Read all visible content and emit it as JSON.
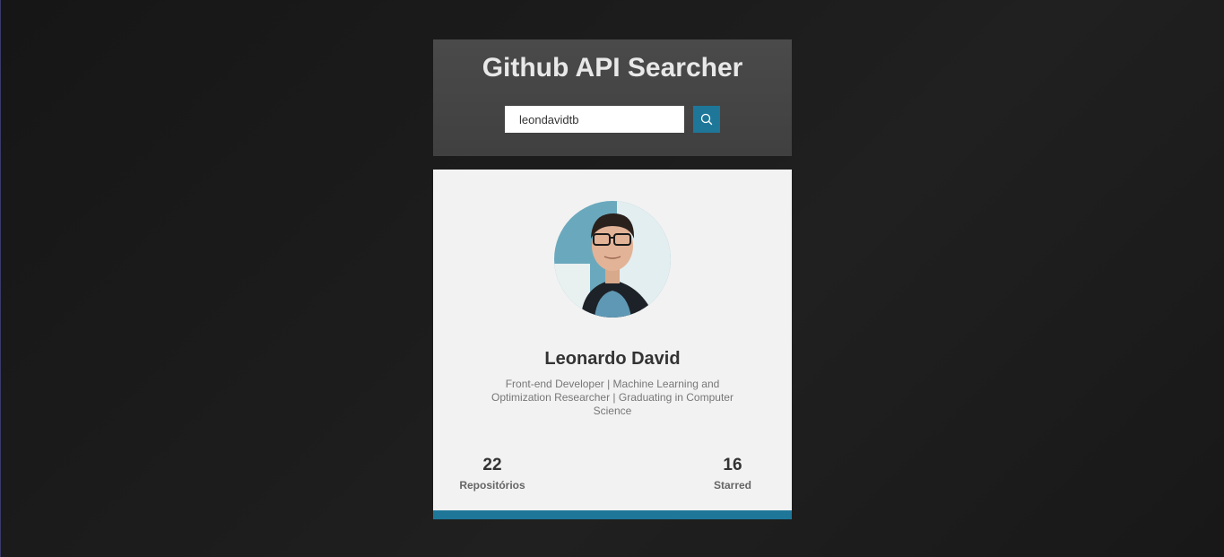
{
  "app": {
    "title": "Github API Searcher"
  },
  "search": {
    "value": "leondavidtb",
    "button_icon": "search-icon"
  },
  "profile": {
    "avatar_icon": "user-avatar",
    "name": "Leonardo David",
    "bio": "Front-end Developer | Machine Learning and Optimization Researcher | Graduating in Computer Science",
    "stats": [
      {
        "value": "22",
        "label": "Repositórios"
      },
      {
        "value": "16",
        "label": "Starred"
      }
    ]
  },
  "colors": {
    "accent": "#1e7799",
    "header_bg": "#444444",
    "card_bg": "#f2f2f2",
    "page_bg": "#1a1a1a"
  }
}
